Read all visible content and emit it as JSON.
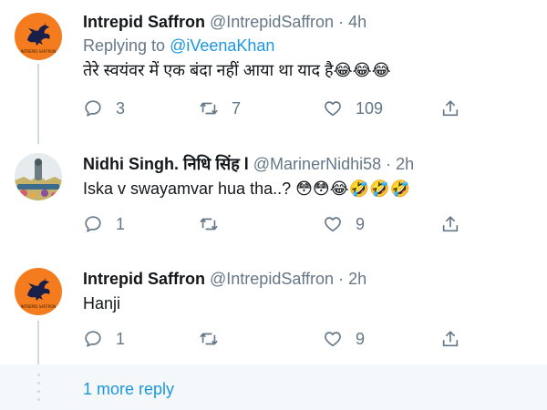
{
  "tweets": [
    {
      "name": "Intrepid Saffron",
      "handle": "@IntrepidSaffron",
      "separator": "·",
      "time": "4h",
      "replying_prefix": "Replying to ",
      "replying_handle": "@iVeenaKhan",
      "text": "तेरे स्वयंवर में एक बंदा नहीं आया था याद है😂😂😂",
      "reply_count": "3",
      "retweet_count": "7",
      "like_count": "109",
      "avatar_text": "INTREPID SAFFRON"
    },
    {
      "name": "Nidhi Singh. निधि सिंह l",
      "handle": "@MarinerNidhi58",
      "separator": "·",
      "time": "2h",
      "text": "Iska v swayamvar hua tha..? 😳😳😂🤣🤣🤣",
      "reply_count": "1",
      "retweet_count": "",
      "like_count": "9"
    },
    {
      "name": "Intrepid Saffron",
      "handle": "@IntrepidSaffron",
      "separator": "·",
      "time": "2h",
      "text": "Hanji",
      "reply_count": "1",
      "retweet_count": "",
      "like_count": "9",
      "avatar_text": "INTREPID SAFFRON"
    }
  ],
  "more_replies": "1 more reply",
  "colors": {
    "link": "#1b95e0",
    "muted": "#657786",
    "avatar_saffron": "#f47c1e"
  },
  "icons": [
    "reply-icon",
    "retweet-icon",
    "like-icon",
    "share-icon"
  ]
}
